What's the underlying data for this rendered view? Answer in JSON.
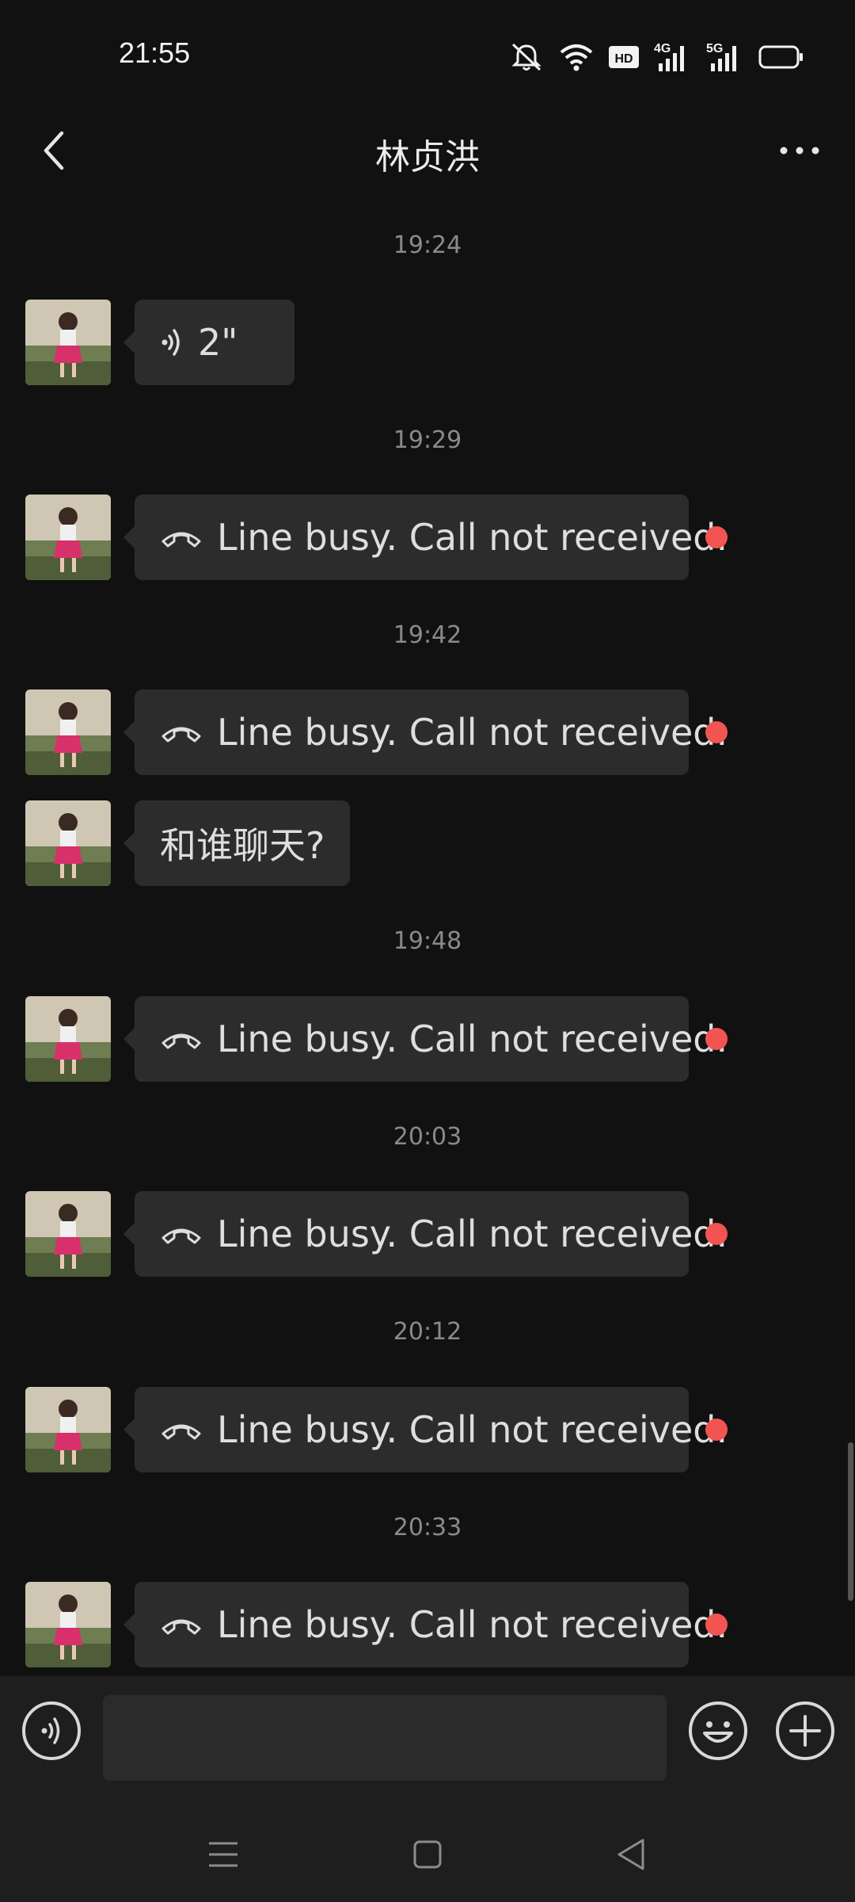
{
  "status_bar": {
    "time": "21:55",
    "network_labels": [
      "HD",
      "4G",
      "5G"
    ]
  },
  "header": {
    "title": "林贞洪"
  },
  "messages": [
    {
      "kind": "timestamp",
      "text": "19:24"
    },
    {
      "kind": "voice",
      "text": "2\""
    },
    {
      "kind": "timestamp",
      "text": "19:29"
    },
    {
      "kind": "call",
      "text": "Line busy. Call not received.",
      "unread": true
    },
    {
      "kind": "timestamp",
      "text": "19:42"
    },
    {
      "kind": "call",
      "text": "Line busy. Call not received.",
      "unread": true
    },
    {
      "kind": "text",
      "text": "和谁聊天?"
    },
    {
      "kind": "timestamp",
      "text": "19:48"
    },
    {
      "kind": "call",
      "text": "Line busy. Call not received.",
      "unread": true
    },
    {
      "kind": "timestamp",
      "text": "20:03"
    },
    {
      "kind": "call",
      "text": "Line busy. Call not received.",
      "unread": true
    },
    {
      "kind": "timestamp",
      "text": "20:12"
    },
    {
      "kind": "call",
      "text": "Line busy. Call not received.",
      "unread": true
    },
    {
      "kind": "timestamp",
      "text": "20:33"
    },
    {
      "kind": "call",
      "text": "Line busy. Call not received.",
      "unread": true
    }
  ],
  "input_bar": {
    "value": "",
    "placeholder": ""
  },
  "icons": {
    "back": "chevron-left-icon",
    "more": "more-dots-icon",
    "voice": "voice-wave-icon",
    "call": "phone-hangup-icon",
    "emoji": "smiley-icon",
    "plus": "plus-circle-icon"
  },
  "colors": {
    "background": "#111111",
    "bubble": "#2c2c2c",
    "unread_dot": "#f25452",
    "timestamp": "#8a8a8a",
    "input_bar": "#1e1e1e"
  }
}
